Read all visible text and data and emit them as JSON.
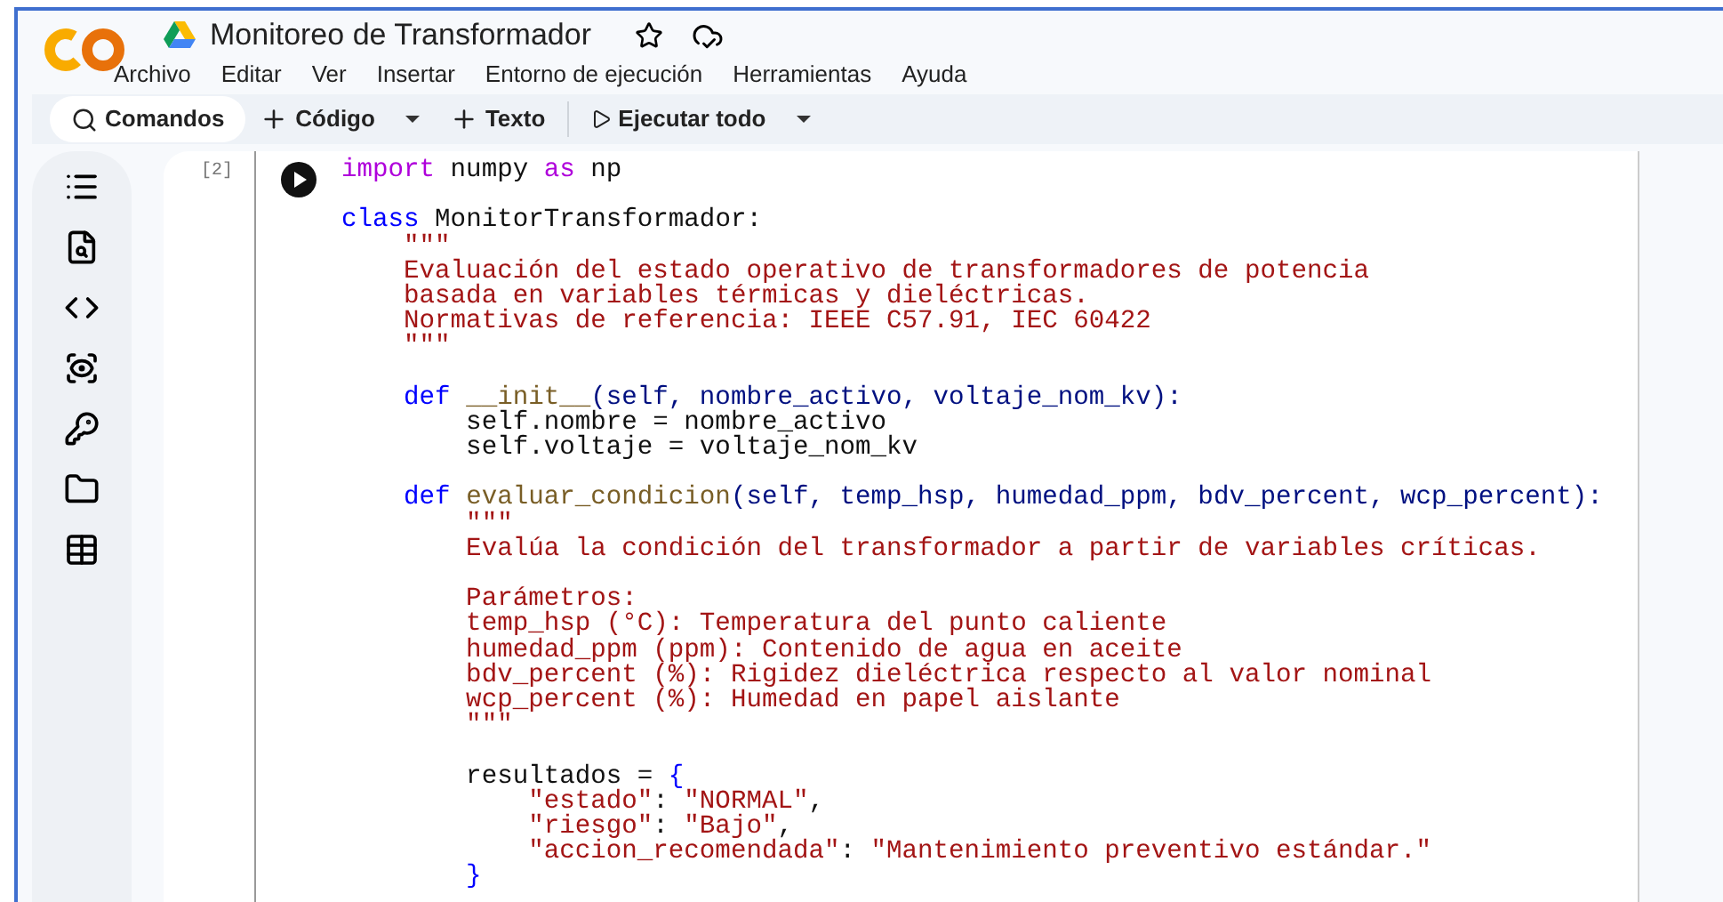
{
  "notebook": {
    "title": "Monitoreo de Transformador"
  },
  "menu": [
    "Archivo",
    "Editar",
    "Ver",
    "Insertar",
    "Entorno de ejecución",
    "Herramientas",
    "Ayuda"
  ],
  "toolbar": [
    {
      "kind": "search",
      "label": "Comandos"
    },
    {
      "kind": "add",
      "label": "Código",
      "dropdown": true
    },
    {
      "kind": "add",
      "label": "Texto",
      "dropdown": false
    },
    {
      "kind": "run",
      "label": "Ejecutar todo",
      "dropdown": true
    }
  ],
  "cell": {
    "counter": "[2]",
    "lines": [
      {
        "kind": "code",
        "tokens": [
          {
            "kind": "keyword",
            "text": "import"
          },
          {
            "kind": "plain",
            "text": " numpy "
          },
          {
            "kind": "keyword",
            "text": "as"
          },
          {
            "kind": "plain",
            "text": " np"
          }
        ]
      },
      {
        "kind": "blank"
      },
      {
        "kind": "code",
        "tokens": [
          {
            "kind": "declaration",
            "text": "class"
          },
          {
            "kind": "plain",
            "text": " MonitorTransformador:"
          }
        ]
      },
      {
        "kind": "code",
        "tokens": [
          {
            "kind": "string",
            "text": "    \"\"\""
          }
        ]
      },
      {
        "kind": "code",
        "tokens": [
          {
            "kind": "string",
            "text": "    Evaluación del estado operativo de transformadores de potencia"
          }
        ]
      },
      {
        "kind": "code",
        "tokens": [
          {
            "kind": "string",
            "text": "    basada en variables térmicas y dieléctricas."
          }
        ]
      },
      {
        "kind": "code",
        "tokens": [
          {
            "kind": "string",
            "text": "    Normativas de referencia: IEEE C57.91, IEC 60422"
          }
        ]
      },
      {
        "kind": "code",
        "tokens": [
          {
            "kind": "string",
            "text": "    \"\"\""
          }
        ]
      },
      {
        "kind": "blank"
      },
      {
        "kind": "code",
        "tokens": [
          {
            "kind": "declaration",
            "text": "    def "
          },
          {
            "kind": "function",
            "text": "__init__"
          },
          {
            "kind": "parameter",
            "text": "(self, nombre_activo, voltaje_nom_kv):"
          }
        ]
      },
      {
        "kind": "code",
        "tokens": [
          {
            "kind": "plain",
            "text": "        self.nombre = nombre_activo"
          }
        ]
      },
      {
        "kind": "code",
        "tokens": [
          {
            "kind": "plain",
            "text": "        self.voltaje = voltaje_nom_kv"
          }
        ]
      },
      {
        "kind": "blank"
      },
      {
        "kind": "code",
        "tokens": [
          {
            "kind": "declaration",
            "text": "    def "
          },
          {
            "kind": "function",
            "text": "evaluar_condicion"
          },
          {
            "kind": "parameter",
            "text": "(self, temp_hsp, humedad_ppm, bdv_percent, wcp_percent):"
          }
        ]
      },
      {
        "kind": "code",
        "tokens": [
          {
            "kind": "string",
            "text": "        \"\"\""
          }
        ]
      },
      {
        "kind": "code",
        "tokens": [
          {
            "kind": "string",
            "text": "        Evalúa la condición del transformador a partir de variables críticas."
          }
        ]
      },
      {
        "kind": "blank"
      },
      {
        "kind": "code",
        "tokens": [
          {
            "kind": "string",
            "text": "        Parámetros:"
          }
        ]
      },
      {
        "kind": "code",
        "tokens": [
          {
            "kind": "string",
            "text": "        temp_hsp (°C): Temperatura del punto caliente"
          }
        ]
      },
      {
        "kind": "code",
        "tokens": [
          {
            "kind": "string",
            "text": "        humedad_ppm (ppm): Contenido de agua en aceite"
          }
        ]
      },
      {
        "kind": "code",
        "tokens": [
          {
            "kind": "string",
            "text": "        bdv_percent (%): Rigidez dieléctrica respecto al valor nominal"
          }
        ]
      },
      {
        "kind": "code",
        "tokens": [
          {
            "kind": "string",
            "text": "        wcp_percent (%): Humedad en papel aislante"
          }
        ]
      },
      {
        "kind": "code",
        "tokens": [
          {
            "kind": "string",
            "text": "        \"\"\""
          }
        ]
      },
      {
        "kind": "blank"
      },
      {
        "kind": "code",
        "tokens": [
          {
            "kind": "plain",
            "text": "        resultados = "
          },
          {
            "kind": "declaration",
            "text": "{"
          }
        ]
      },
      {
        "kind": "code",
        "tokens": [
          {
            "kind": "string",
            "text": "            \"estado\""
          },
          {
            "kind": "plain",
            "text": ": "
          },
          {
            "kind": "string",
            "text": "\"NORMAL\""
          },
          {
            "kind": "plain",
            "text": ","
          }
        ]
      },
      {
        "kind": "code",
        "tokens": [
          {
            "kind": "string",
            "text": "            \"riesgo\""
          },
          {
            "kind": "plain",
            "text": ": "
          },
          {
            "kind": "string",
            "text": "\"Bajo\""
          },
          {
            "kind": "plain",
            "text": ","
          }
        ]
      },
      {
        "kind": "code",
        "tokens": [
          {
            "kind": "string",
            "text": "            \"accion_recomendada\""
          },
          {
            "kind": "plain",
            "text": ": "
          },
          {
            "kind": "string",
            "text": "\"Mantenimiento preventivo estándar.\""
          }
        ]
      },
      {
        "kind": "code",
        "tokens": [
          {
            "kind": "declaration",
            "text": "        }"
          }
        ]
      }
    ]
  }
}
